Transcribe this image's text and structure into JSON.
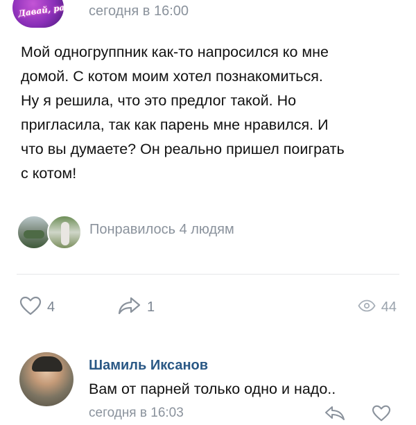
{
  "post": {
    "group_avatar_text": "Давай, расскажи",
    "group_avatar_subtext": "расскажи",
    "time": "сегодня в 16:00",
    "text": "Мой одногруппник как-то напросился ко мне\nдомой. С котом моим хотел познакомиться.\nНу я решила, что это предлог такой. Но\nпригласила, так как парень мне нравился. И\nчто вы думаете? Он реально пришел поиграть\nс котом!"
  },
  "likes": {
    "text": "Понравилось 4 людям"
  },
  "actions": {
    "like_count": "4",
    "share_count": "1",
    "views_count": "44",
    "icons": {
      "like": "heart-icon",
      "share": "share-arrow-icon",
      "views": "eye-icon"
    }
  },
  "comment": {
    "author": "Шамиль Иксанов",
    "text": "Вам от парней только одно и надо..",
    "time": "сегодня в 16:03",
    "icons": {
      "reply": "reply-arrow-icon",
      "like": "heart-icon"
    }
  },
  "colors": {
    "link": "#2a5885",
    "muted": "#8a929c",
    "icon": "#9aa3ad"
  }
}
